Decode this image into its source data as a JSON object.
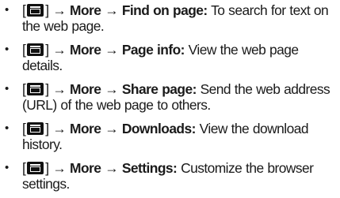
{
  "items": [
    {
      "open_bracket": "[",
      "close_bracket": "]",
      "arrow1": "→",
      "more": "More",
      "arrow2": "→",
      "option": "Find on page:",
      "desc_line1": " To search for text on",
      "desc_line2": "the web page."
    },
    {
      "open_bracket": "[",
      "close_bracket": "]",
      "arrow1": "→",
      "more": "More",
      "arrow2": "→",
      "option": "Page info:",
      "desc_line1": " View the web page",
      "desc_line2": "details."
    },
    {
      "open_bracket": "[",
      "close_bracket": "]",
      "arrow1": "→",
      "more": "More",
      "arrow2": "→",
      "option": "Share page:",
      "desc_line1": " Send the web address",
      "desc_line2": "(URL) of the web page to others."
    },
    {
      "open_bracket": "[",
      "close_bracket": "]",
      "arrow1": "→",
      "more": "More",
      "arrow2": "→",
      "option": "Downloads:",
      "desc_line1": " View the download",
      "desc_line2": "history."
    },
    {
      "open_bracket": "[",
      "close_bracket": "]",
      "arrow1": "→",
      "more": "More",
      "arrow2": "→",
      "option": "Settings:",
      "desc_line1": " Customize the browser",
      "desc_line2": "settings."
    }
  ],
  "bullet_glyph": "•",
  "menu_key_icon": "menu-key-icon"
}
